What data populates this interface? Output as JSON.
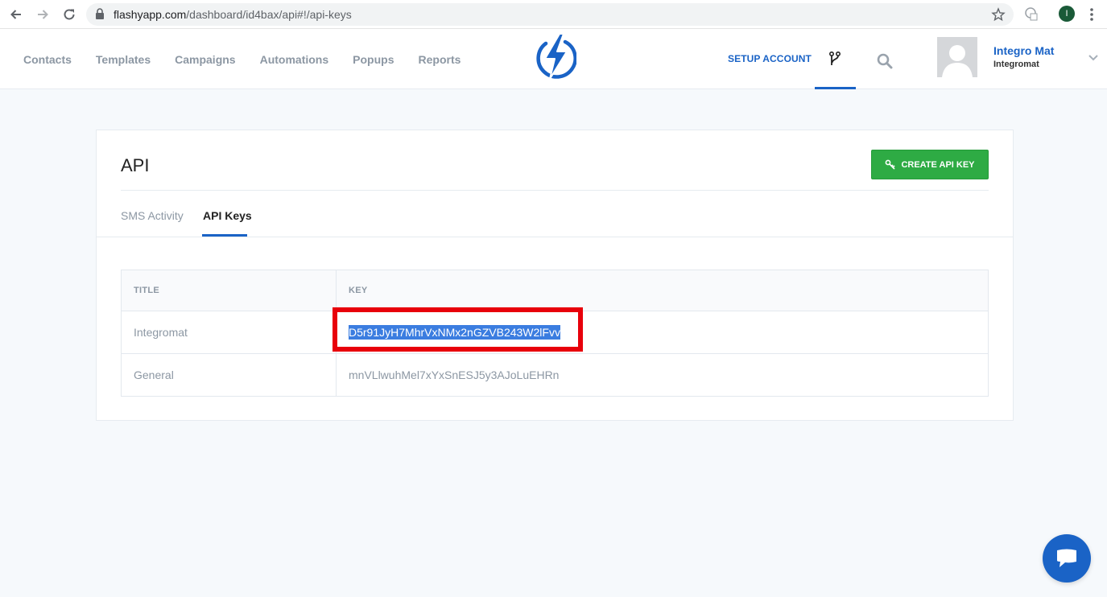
{
  "browser": {
    "url_host": "flashyapp.com",
    "url_path": "/dashboard/id4bax/api#!/api-keys",
    "profile_initial": "I"
  },
  "header": {
    "nav": [
      "Contacts",
      "Templates",
      "Campaigns",
      "Automations",
      "Popups",
      "Reports"
    ],
    "setup_label": "SETUP ACCOUNT",
    "user_name": "Integro Mat",
    "user_org": "Integromat"
  },
  "page": {
    "title": "API",
    "create_button": "CREATE API KEY",
    "tabs": [
      "SMS Activity",
      "API Keys"
    ],
    "active_tab": "API Keys"
  },
  "table": {
    "headers": [
      "TITLE",
      "KEY"
    ],
    "rows": [
      {
        "title": "Integromat",
        "key": "D5r91JyH7MhrVxNMx2nGZVB243W2lFvv"
      },
      {
        "title": "General",
        "key": "mnVLlwuhMel7xYxSnESJ5y3AJoLuEHRn"
      }
    ]
  },
  "colors": {
    "accent": "#1a63c6",
    "create_button": "#2eab44",
    "highlight": "#e8000b"
  }
}
